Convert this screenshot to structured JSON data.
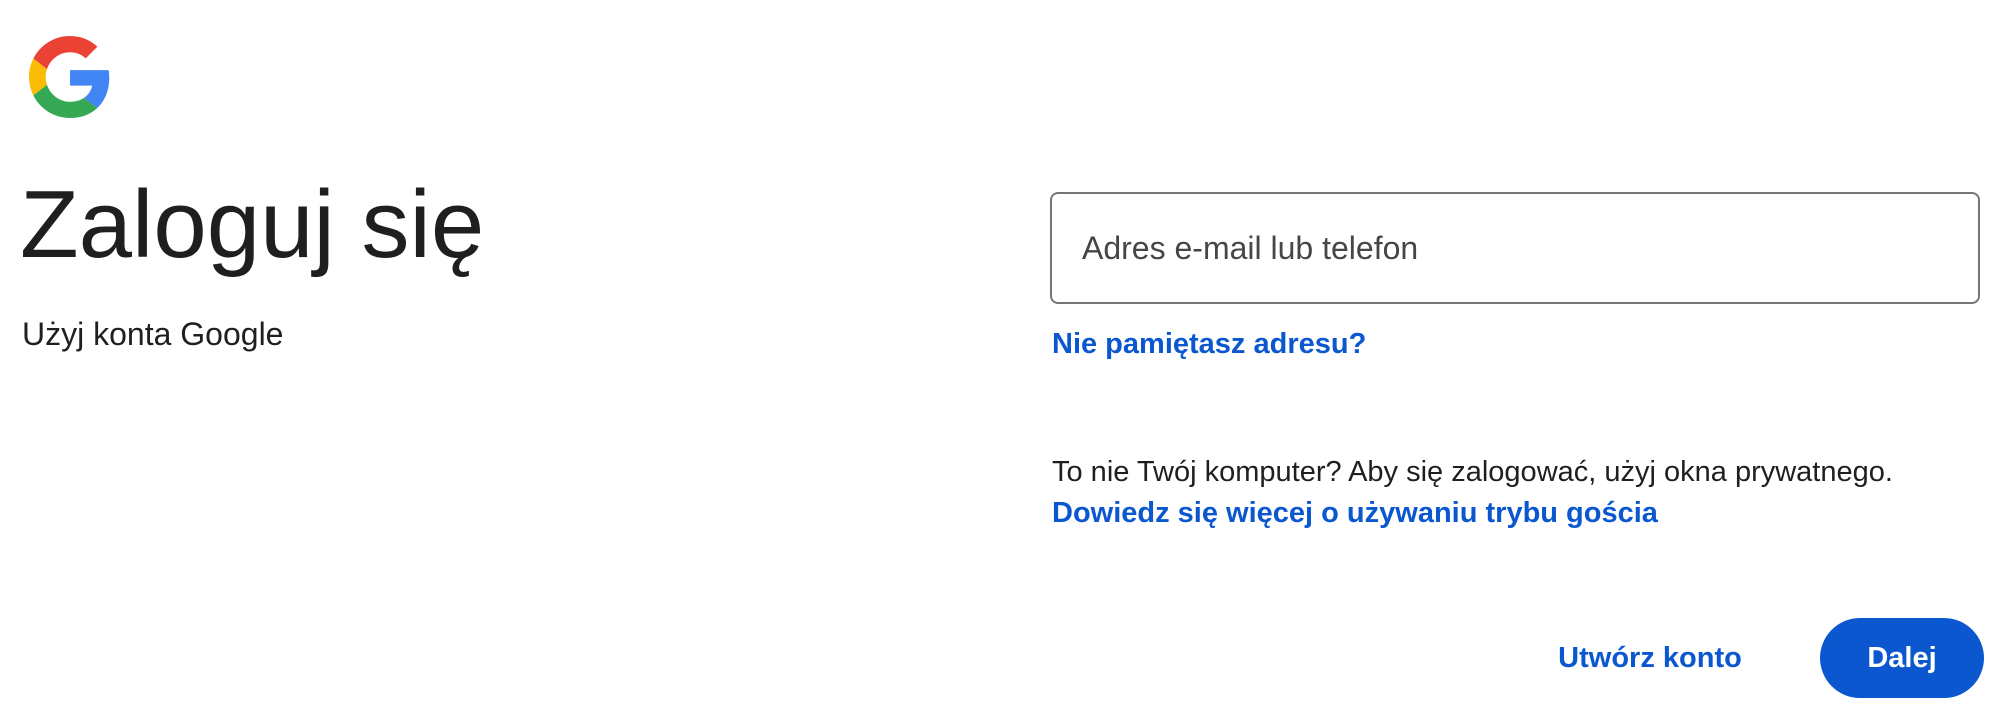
{
  "brand": {
    "logo_icon": "google-g-logo-icon",
    "colors": {
      "red": "#EA4335",
      "yellow": "#FBBC05",
      "green": "#34A853",
      "blue": "#4285F4"
    }
  },
  "header": {
    "title": "Zaloguj się",
    "subtitle": "Użyj konta Google"
  },
  "form": {
    "email_placeholder": "Adres e-mail lub telefon",
    "email_value": "",
    "forgot_link": "Nie pamiętasz adresu?"
  },
  "guest": {
    "text": "To nie Twój komputer? Aby się zalogować, użyj okna prywatnego.",
    "link": "Dowiedz się więcej o używaniu trybu gościa"
  },
  "actions": {
    "create_account": "Utwórz konto",
    "next": "Dalej"
  },
  "theme": {
    "accent": "#0B57D0",
    "text": "#1F1F1F",
    "border": "#747775"
  }
}
